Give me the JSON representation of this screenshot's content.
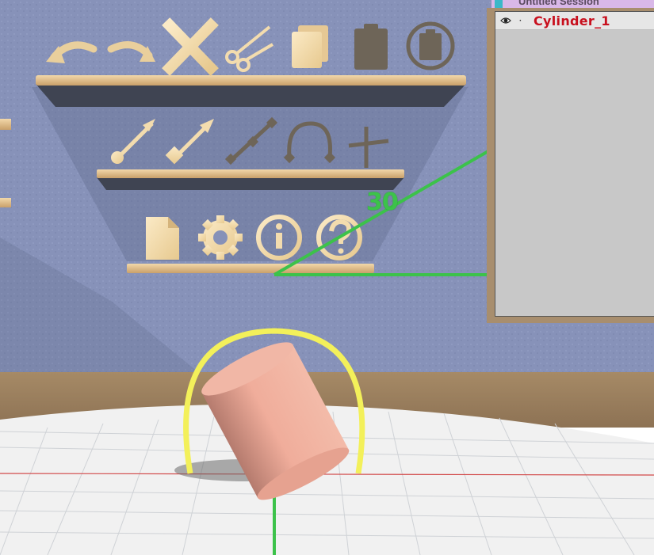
{
  "session": {
    "tab_title": "Untitled Session"
  },
  "outliner": {
    "rows": [
      {
        "name": "Cylinder_1",
        "visible_icon": "eye-icon",
        "bullet": "·"
      }
    ]
  },
  "toolbar_shelves": {
    "edit": [
      "undo-icon",
      "redo-icon",
      "delete-icon",
      "cut-icon",
      "copy-icon",
      "paste-icon",
      "paste-special-icon"
    ],
    "create": [
      "ray-icon",
      "vector-icon",
      "segment-icon",
      "arc-icon",
      "axis-cross-icon"
    ],
    "system": [
      "file-icon",
      "settings-icon",
      "info-icon",
      "help-icon"
    ]
  },
  "angle_readout": {
    "value": "30"
  },
  "colors": {
    "wall": "#8691b8",
    "shelf_wood": "#e2c290",
    "icon_cream": "#f3dcae",
    "icon_dim": "#6e6558",
    "angle_green": "#3cc24a",
    "ring_yellow": "#f3f05a",
    "cylinder": "#e9a593",
    "floor": "#efefef",
    "axis_red": "#d24a4a",
    "object_name_red": "#c8101e"
  }
}
